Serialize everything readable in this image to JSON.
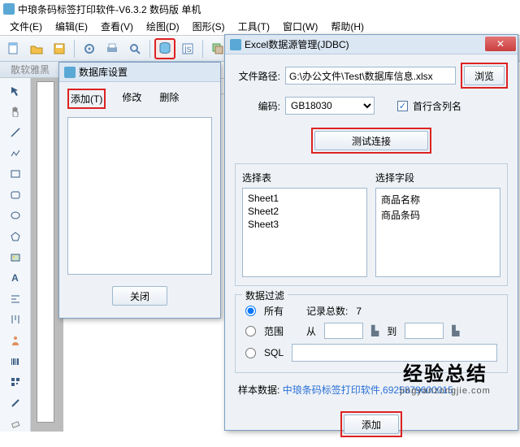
{
  "app": {
    "title": "中琅条码标签打印软件-V6.3.2 数码版 单机"
  },
  "menu": {
    "file": "文件(E)",
    "edit": "编辑(E)",
    "view": "查看(V)",
    "draw": "绘图(D)",
    "shape": "图形(S)",
    "tool": "工具(T)",
    "window": "窗口(W)",
    "help": "帮助(H)"
  },
  "ribbon_tab": "散软雅黑",
  "db_dlg": {
    "title": "数据库设置",
    "tabs": {
      "add": "添加(T)",
      "modify": "修改",
      "delete": "删除"
    },
    "close_btn": "关闭"
  },
  "excel_dlg": {
    "title": "Excel数据源管理(JDBC)",
    "path_label": "文件路径:",
    "path_value": "G:\\办公文件\\Test\\数据库信息.xlsx",
    "browse": "浏览",
    "encoding_label": "编码:",
    "encoding_value": "GB18030",
    "header_chk": "首行含列名",
    "test": "测试连接",
    "select_table": "选择表",
    "select_field": "选择字段",
    "sheets": [
      "Sheet1",
      "Sheet2",
      "Sheet3"
    ],
    "fields": [
      "商品名称",
      "商品条码"
    ],
    "filter_legend": "数据过滤",
    "all": "所有",
    "total_label": "记录总数:",
    "total": "7",
    "range": "范围",
    "from": "从",
    "to": "到",
    "sql": "SQL",
    "sample_label": "样本数据:",
    "sample_value": "中琅条码标签打印软件,6925879600015",
    "add": "添加"
  },
  "watermark": {
    "line1": "经验总结",
    "line2": "jingyanzongjie.com"
  }
}
